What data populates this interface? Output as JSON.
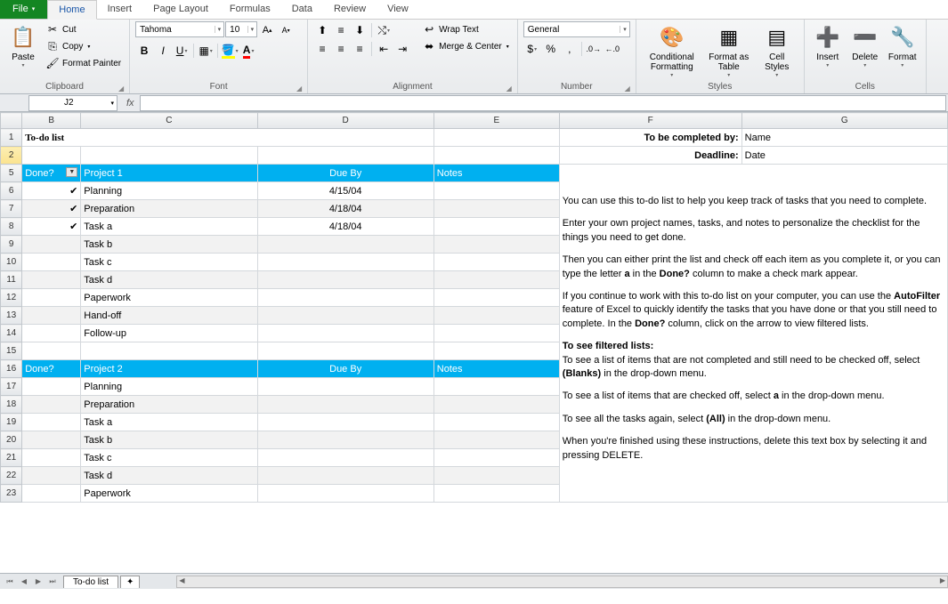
{
  "tabs": {
    "file": "File",
    "home": "Home",
    "insert": "Insert",
    "pagelayout": "Page Layout",
    "formulas": "Formulas",
    "data": "Data",
    "review": "Review",
    "view": "View"
  },
  "clipboard": {
    "paste": "Paste",
    "cut": "Cut",
    "copy": "Copy",
    "painter": "Format Painter",
    "label": "Clipboard"
  },
  "font": {
    "name": "Tahoma",
    "size": "10",
    "bold": "B",
    "italic": "I",
    "underline": "U",
    "label": "Font"
  },
  "alignment": {
    "wrap": "Wrap Text",
    "merge": "Merge & Center",
    "label": "Alignment"
  },
  "number": {
    "format": "General",
    "label": "Number"
  },
  "styles": {
    "cond": "Conditional Formatting",
    "table": "Format as Table",
    "cell": "Cell Styles",
    "label": "Styles"
  },
  "cells": {
    "insert": "Insert",
    "delete": "Delete",
    "format": "Format",
    "label": "Cells"
  },
  "namebox": "J2",
  "cols": [
    "B",
    "C",
    "D",
    "E",
    "F",
    "G"
  ],
  "title": "To-do list",
  "meta": {
    "byLabel": "To be completed by:",
    "byVal": "Name",
    "dlLabel": "Deadline:",
    "dlVal": "Date"
  },
  "hdr": {
    "done": "Done?",
    "proj1": "Project 1",
    "proj2": "Project 2",
    "due": "Due By",
    "notes": "Notes"
  },
  "p1": [
    {
      "done": "✔",
      "task": "Planning",
      "due": "4/15/04"
    },
    {
      "done": "✔",
      "task": "Preparation",
      "due": "4/18/04"
    },
    {
      "done": "✔",
      "task": "Task a",
      "due": "4/18/04"
    },
    {
      "done": "",
      "task": "Task b",
      "due": ""
    },
    {
      "done": "",
      "task": "Task c",
      "due": ""
    },
    {
      "done": "",
      "task": "Task d",
      "due": ""
    },
    {
      "done": "",
      "task": "Paperwork",
      "due": ""
    },
    {
      "done": "",
      "task": "Hand-off",
      "due": ""
    },
    {
      "done": "",
      "task": "Follow-up",
      "due": ""
    }
  ],
  "p2": [
    {
      "task": "Planning"
    },
    {
      "task": "Preparation"
    },
    {
      "task": "Task a"
    },
    {
      "task": "Task b"
    },
    {
      "task": "Task c"
    },
    {
      "task": "Task d"
    },
    {
      "task": "Paperwork"
    }
  ],
  "info": {
    "p1": "You can use this to-do list to help you keep track of tasks that you need to complete.",
    "p2": "Enter your own project names, tasks, and notes to personalize the checklist for the things you need to get done.",
    "p3a": "Then you can either print the list and check off each item as you complete it, or you can type the letter ",
    "p3b": " in the ",
    "p3c": " column to make a check mark appear.",
    "p4a": "If you continue to work with this to-do list on your computer, you can use the ",
    "p4b": " feature of Excel to quickly identify the tasks that you have done or that you still need to complete. In the ",
    "p4c": " column, click on the arrow to view filtered lists.",
    "p5": "To see filtered lists:",
    "p6a": "To see a list of items that are not completed and still need to be checked off, select ",
    "p6b": " in the drop-down menu.",
    "p7a": "To see a list of items that are checked off, select ",
    "p7b": " in the drop-down menu.",
    "p8a": "To see all the tasks again, select ",
    "p8b": " in the drop-down menu.",
    "p9": "When you're finished using these instructions, delete this text box by selecting it and pressing DELETE.",
    "kw_a": "a",
    "kw_done": "Done?",
    "kw_af": "AutoFilter",
    "kw_blanks": "(Blanks)",
    "kw_all": "(All)"
  },
  "sheet": "To-do list"
}
